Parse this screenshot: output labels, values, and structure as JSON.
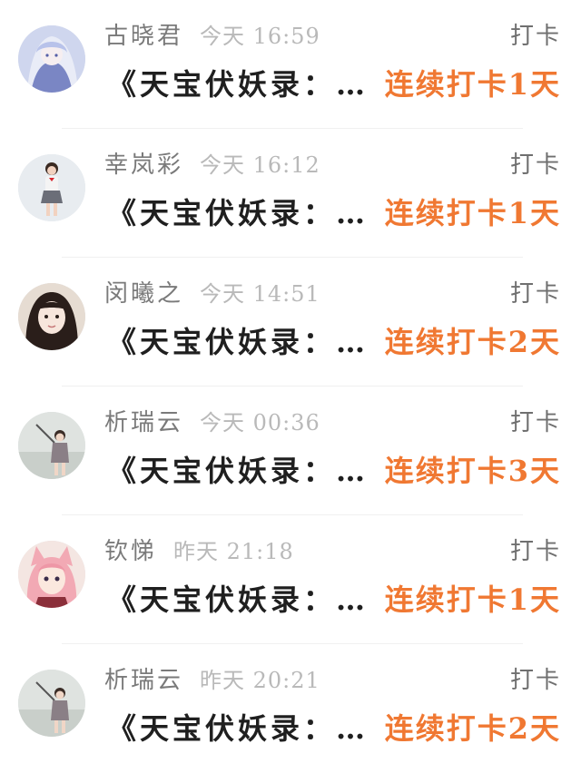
{
  "colors": {
    "accent": "#f07832",
    "username": "#7a7a7a",
    "time": "#b9b9b9",
    "title": "#1f1f1f"
  },
  "rows": [
    {
      "avatar": "anime-girl-blue-avatar",
      "username": "古晓君",
      "time": "今天 16:59",
      "action": "打卡",
      "title": "《天宝伏妖录：…",
      "streak": "连续打卡1天"
    },
    {
      "avatar": "child-photo-avatar",
      "username": "幸岚彩",
      "time": "今天 16:12",
      "action": "打卡",
      "title": "《天宝伏妖录：…",
      "streak": "连续打卡1天"
    },
    {
      "avatar": "girl-selfie-avatar",
      "username": "闵曦之",
      "time": "今天 14:51",
      "action": "打卡",
      "title": "《天宝伏妖录：…",
      "streak": "连续打卡2天"
    },
    {
      "avatar": "child-selfie-stick-avatar",
      "username": "析瑞云",
      "time": "今天 00:36",
      "action": "打卡",
      "title": "《天宝伏妖录：…",
      "streak": "连续打卡3天"
    },
    {
      "avatar": "anime-fox-girl-avatar",
      "username": "钦悌",
      "time": "昨天 21:18",
      "action": "打卡",
      "title": "《天宝伏妖录：…",
      "streak": "连续打卡1天"
    },
    {
      "avatar": "child-selfie-stick-avatar",
      "username": "析瑞云",
      "time": "昨天 20:21",
      "action": "打卡",
      "title": "《天宝伏妖录：…",
      "streak": "连续打卡2天"
    }
  ]
}
